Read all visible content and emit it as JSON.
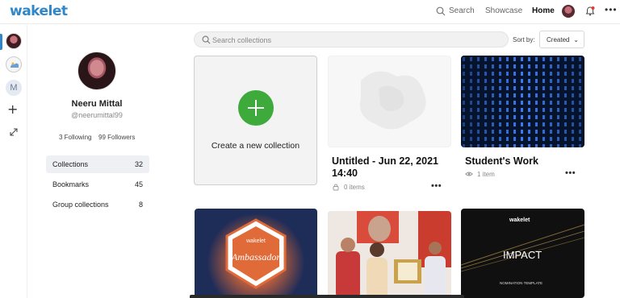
{
  "app": {
    "logo": "wakelet"
  },
  "topnav": {
    "search": "Search",
    "showcase": "Showcase",
    "home": "Home",
    "more": "•••"
  },
  "rail": {
    "space_letter": "M",
    "add": "+"
  },
  "profile": {
    "name": "Neeru Mittal",
    "handle": "@neerumittal99",
    "following": "3 Following",
    "followers": "99 Followers"
  },
  "menu": [
    {
      "label": "Collections",
      "count": "32"
    },
    {
      "label": "Bookmarks",
      "count": "45"
    },
    {
      "label": "Group collections",
      "count": "8"
    }
  ],
  "search": {
    "placeholder": "Search collections"
  },
  "sort": {
    "label": "Sort by:",
    "value": "Created",
    "chevron": "⌄"
  },
  "create": {
    "label": "Create a new collection"
  },
  "collections": [
    {
      "title": "Untitled - Jun 22, 2021 14:40",
      "meta": "0 items",
      "more": "•••"
    },
    {
      "title": "Student's Work",
      "meta": "1 item",
      "more": "•••"
    }
  ],
  "thumb_text": {
    "ambassador_brand": "wakelet",
    "ambassador_word": "Ambassador",
    "impact_brand": "wakelet",
    "impact_word": "IMPACT",
    "impact_sub": "NOMINATION TEMPLATE"
  },
  "colors": {
    "brand": "#2f86c9",
    "create_plus": "#3eaa3c",
    "ambassador_orange": "#e06a38"
  }
}
